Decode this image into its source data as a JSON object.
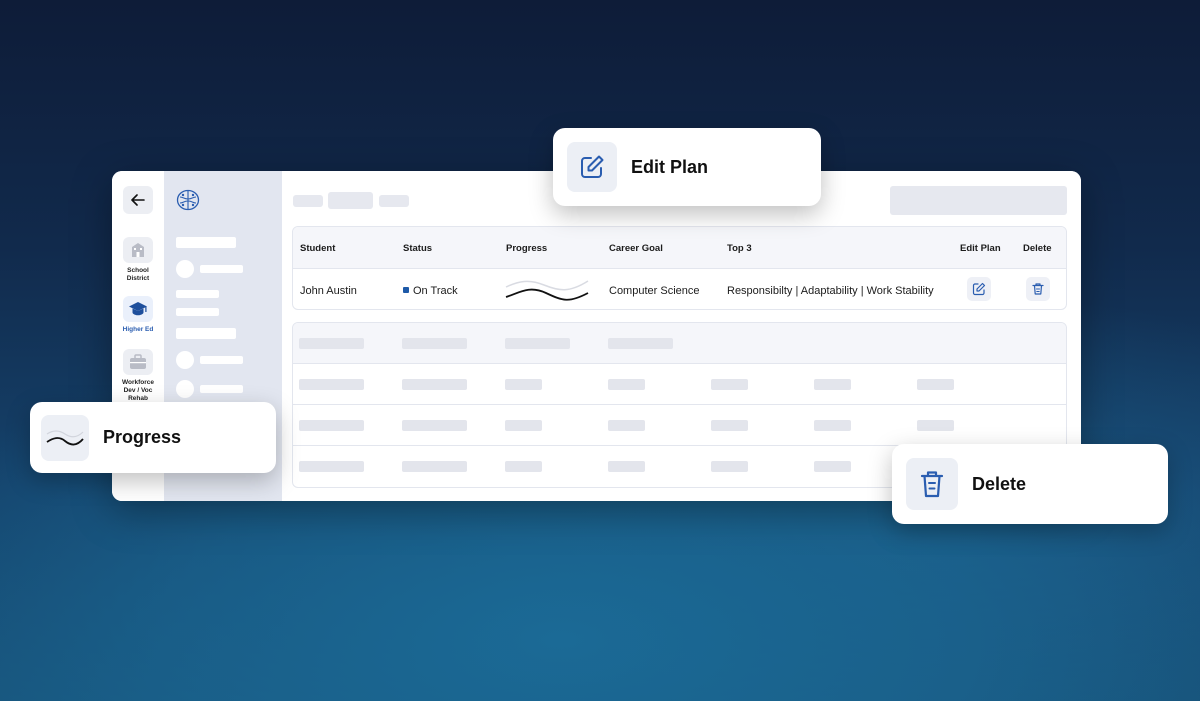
{
  "rail": {
    "items": [
      {
        "label_line1": "School",
        "label_line2": "District",
        "icon": "school-icon"
      },
      {
        "label_line1": "Higher Ed",
        "label_line2": "",
        "icon": "graduation-cap-icon"
      },
      {
        "label_line1": "Workforce",
        "label_line2": "Dev / Voc",
        "label_line3": "Rehab",
        "icon": "briefcase-icon"
      }
    ]
  },
  "table": {
    "columns": [
      "Student",
      "Status",
      "Progress",
      "Career Goal",
      "Top 3",
      "Edit Plan",
      "Delete"
    ],
    "row": {
      "student": "John Austin",
      "status": "On Track",
      "career_goal": "Computer Science",
      "top3": "Responsibilty | Adaptability | Work Stability"
    }
  },
  "cards": {
    "edit_plan": "Edit Plan",
    "progress": "Progress",
    "delete": "Delete"
  },
  "colors": {
    "accent": "#2a5db0",
    "status_on_track": "#1e5aa8",
    "sidebar": "#e2e6f0"
  }
}
